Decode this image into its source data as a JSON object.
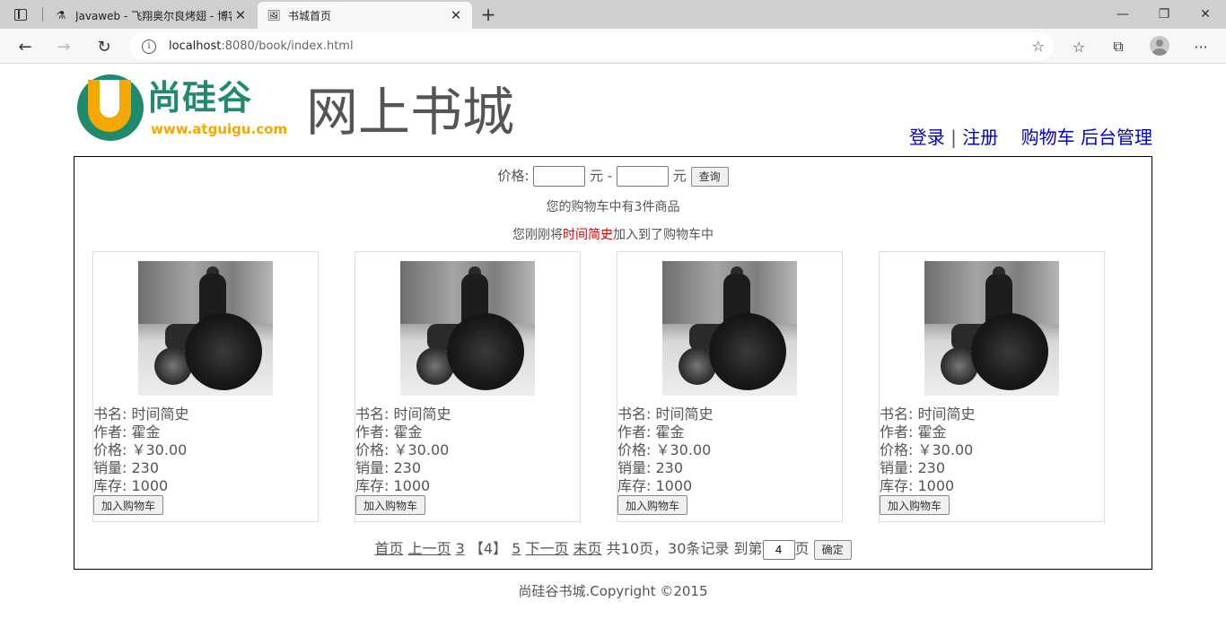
{
  "browser": {
    "tabs": [
      {
        "title": "Javaweb - 飞翔奥尔良烤翅 - 博客",
        "active": false
      },
      {
        "title": "书城首页",
        "active": true
      }
    ],
    "url_host": "localhost",
    "url_rest": ":8080/book/index.html"
  },
  "header": {
    "logo_cn": "尚硅谷",
    "logo_web": "www.atguigu.com",
    "site_title": "网上书城",
    "login": "登录",
    "separator": "|",
    "register": "注册",
    "cart": "购物车",
    "admin": "后台管理"
  },
  "search": {
    "price_label": "价格:",
    "unit1": "元 -",
    "unit2": "元",
    "min_value": "",
    "max_value": "",
    "button": "查询"
  },
  "cart_info": "您的购物车中有3件商品",
  "last_added": {
    "prefix": "您刚刚将",
    "book": "时间简史",
    "suffix": "加入到了购物车中"
  },
  "books": [
    {
      "name_label": "书名:",
      "name": "时间简史",
      "author_label": "作者:",
      "author": "霍金",
      "price_label": "价格:",
      "price": "￥30.00",
      "sales_label": "销量:",
      "sales": "230",
      "stock_label": "库存:",
      "stock": "1000",
      "button": "加入购物车"
    },
    {
      "name_label": "书名:",
      "name": "时间简史",
      "author_label": "作者:",
      "author": "霍金",
      "price_label": "价格:",
      "price": "￥30.00",
      "sales_label": "销量:",
      "sales": "230",
      "stock_label": "库存:",
      "stock": "1000",
      "button": "加入购物车"
    },
    {
      "name_label": "书名:",
      "name": "时间简史",
      "author_label": "作者:",
      "author": "霍金",
      "price_label": "价格:",
      "price": "￥30.00",
      "sales_label": "销量:",
      "sales": "230",
      "stock_label": "库存:",
      "stock": "1000",
      "button": "加入购物车"
    },
    {
      "name_label": "书名:",
      "name": "时间简史",
      "author_label": "作者:",
      "author": "霍金",
      "price_label": "价格:",
      "price": "￥30.00",
      "sales_label": "销量:",
      "sales": "230",
      "stock_label": "库存:",
      "stock": "1000",
      "button": "加入购物车"
    }
  ],
  "pager": {
    "first": "首页",
    "prev": "上一页",
    "page_prev": "3",
    "current": "【4】",
    "page_next": "5",
    "next": "下一页",
    "last": "末页",
    "summary": "共10页，30条记录",
    "goto_prefix": "到第",
    "goto_value": "4",
    "goto_suffix": "页",
    "confirm": "确定"
  },
  "footer": "尚硅谷书城.Copyright ©2015"
}
